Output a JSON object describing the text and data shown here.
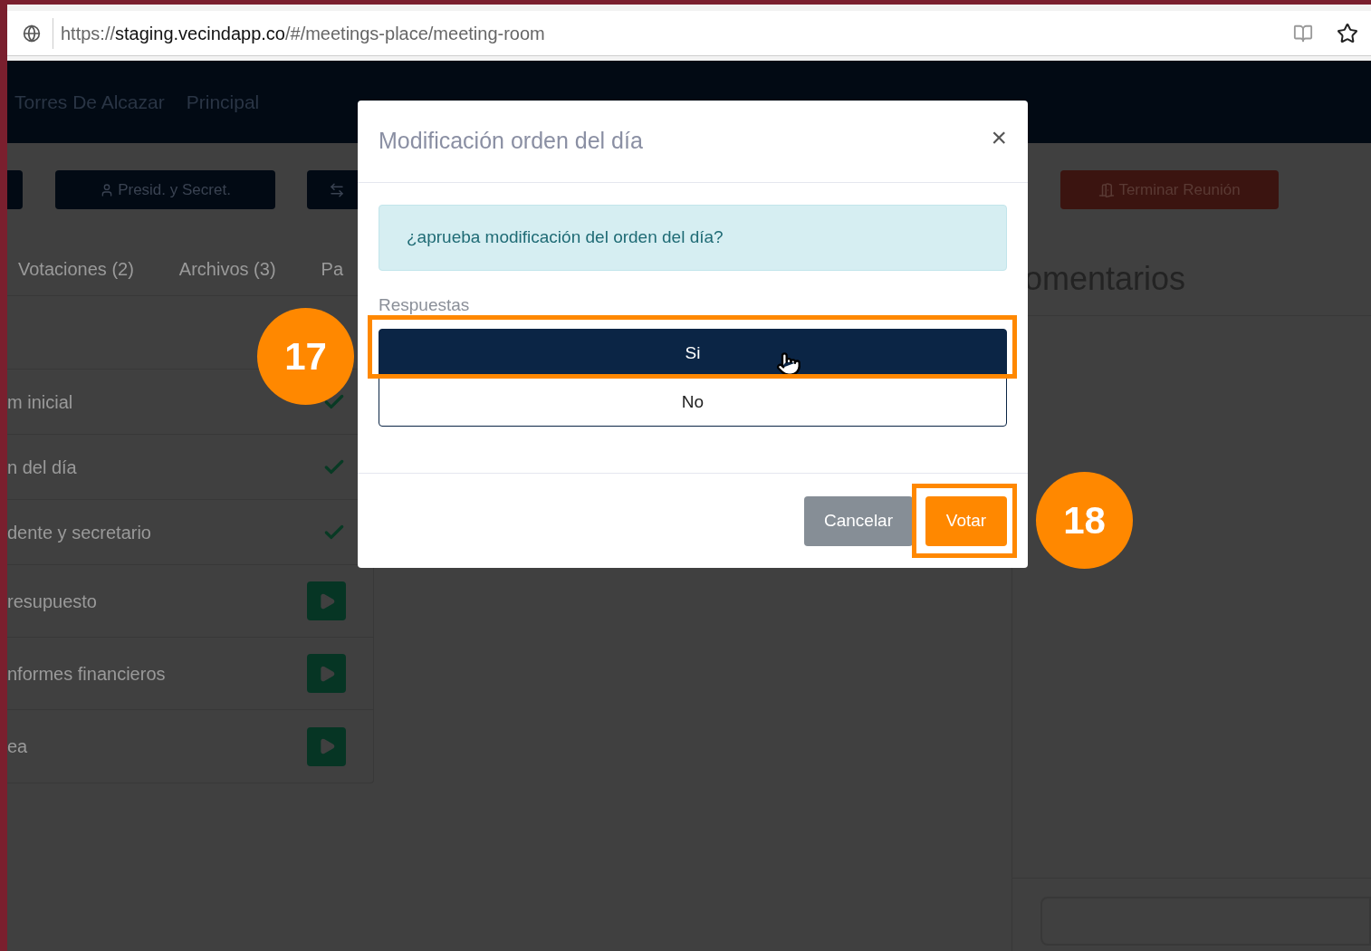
{
  "browser": {
    "url_prefix": "https://",
    "url_host": "staging.vecindapp.co",
    "url_path": "/#/meetings-place/meeting-room"
  },
  "navbar": {
    "items": [
      "Torres De Alcazar",
      "Principal"
    ]
  },
  "toolbar": {
    "buttons": [
      {
        "kind": "blank"
      },
      {
        "kind": "user",
        "label": "Presid. y Secret."
      },
      {
        "kind": "swap"
      },
      {
        "kind": "exit",
        "label": "Terminar Reunión"
      }
    ]
  },
  "tabs": [
    {
      "label": "Votaciones (2)"
    },
    {
      "label": "Archivos (3)"
    },
    {
      "label": "Pa"
    }
  ],
  "agenda": [
    {
      "text": "m inicial",
      "kind": "done"
    },
    {
      "text": "n del día",
      "kind": "done"
    },
    {
      "text": "dente y secretario",
      "kind": "done"
    },
    {
      "text": "resupuesto",
      "kind": "pending"
    },
    {
      "text": "nformes financieros",
      "kind": "pending"
    },
    {
      "text": "ea",
      "kind": "pending"
    }
  ],
  "comments": {
    "title": "omentarios"
  },
  "modal": {
    "title": "Modificación orden del día",
    "close": "×",
    "question": "¿aprueba modificación del orden del día?",
    "answers_label": "Respuestas",
    "answers": [
      {
        "label": "Si",
        "selected": true
      },
      {
        "label": "No",
        "selected": false
      }
    ],
    "buttons": [
      {
        "kind": "secondary",
        "label": "Cancelar"
      },
      {
        "kind": "primary",
        "label": "Votar"
      }
    ]
  },
  "annotations": [
    {
      "number": "17"
    },
    {
      "number": "18"
    }
  ]
}
